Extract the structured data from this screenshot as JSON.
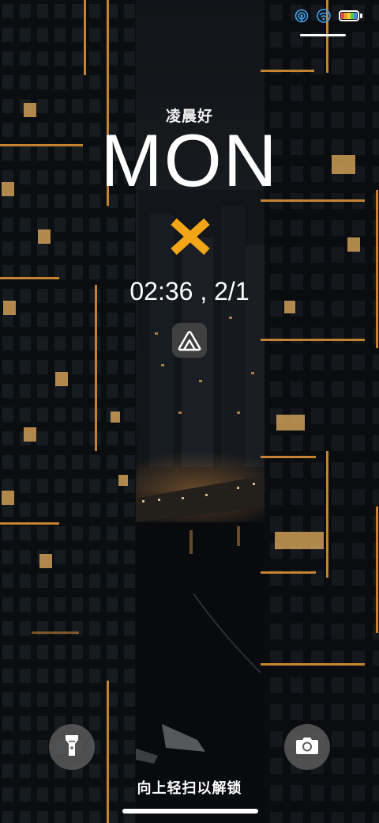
{
  "status_bar": {
    "icons": [
      "hotspot-icon",
      "wifi-icon",
      "battery-icon"
    ]
  },
  "lockscreen": {
    "greeting": "凌晨好",
    "day": "MON",
    "weather_icon": "close-x-icon",
    "weather_color": "#f2a516",
    "time_date": "02:36 , 2/1",
    "shortcut_icon": "mountain-logo-icon",
    "unlock_hint": "向上轻扫以解锁"
  },
  "shortcuts": {
    "left": "flashlight-icon",
    "right": "camera-icon"
  }
}
